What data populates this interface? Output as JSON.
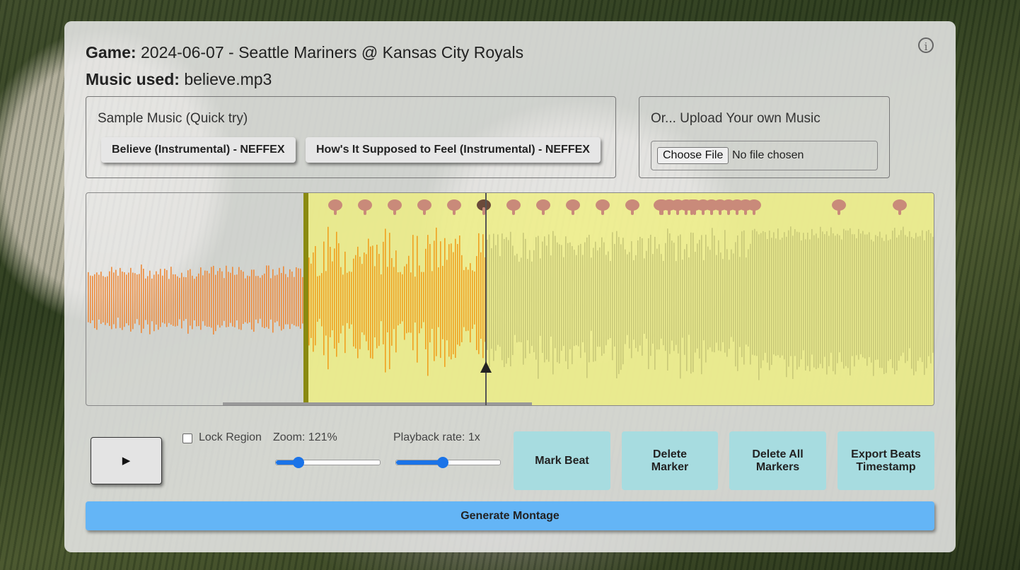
{
  "header": {
    "game_label": "Game:",
    "game_value": "2024-06-07 - Seattle Mariners @ Kansas City Royals",
    "music_label": "Music used:",
    "music_value": "believe.mp3",
    "info_glyph": "i"
  },
  "sample_music": {
    "caption": "Sample Music (Quick try)",
    "buttons": [
      "Believe (Instrumental) - NEFFEX",
      "How's It Supposed to Feel (Instrumental) - NEFFEX"
    ]
  },
  "upload": {
    "caption": "Or... Upload Your own Music",
    "choose_label": "Choose File",
    "status": "No file chosen"
  },
  "waveform": {
    "region_color": "#f0f07a",
    "played_color": "#ee8a3a",
    "region_wave_color": "#f0a020",
    "unplayed_color": "#c8c878",
    "marker_icon": "pointing-down-hand-icon",
    "playhead_fraction": 0.47,
    "region_start_fraction": 0.258
  },
  "controls": {
    "play_icon": "▶",
    "lock_label": "Lock Region",
    "lock_checked": false,
    "zoom_label": "Zoom: 121%",
    "zoom_value": 0.22,
    "rate_label": "Playback rate: 1x",
    "rate_value": 0.45
  },
  "actions": {
    "mark_beat": "Mark Beat",
    "delete_marker": "Delete Marker",
    "delete_all": "Delete All Markers",
    "export": "Export Beats Timestamp"
  },
  "generate": "Generate Montage"
}
